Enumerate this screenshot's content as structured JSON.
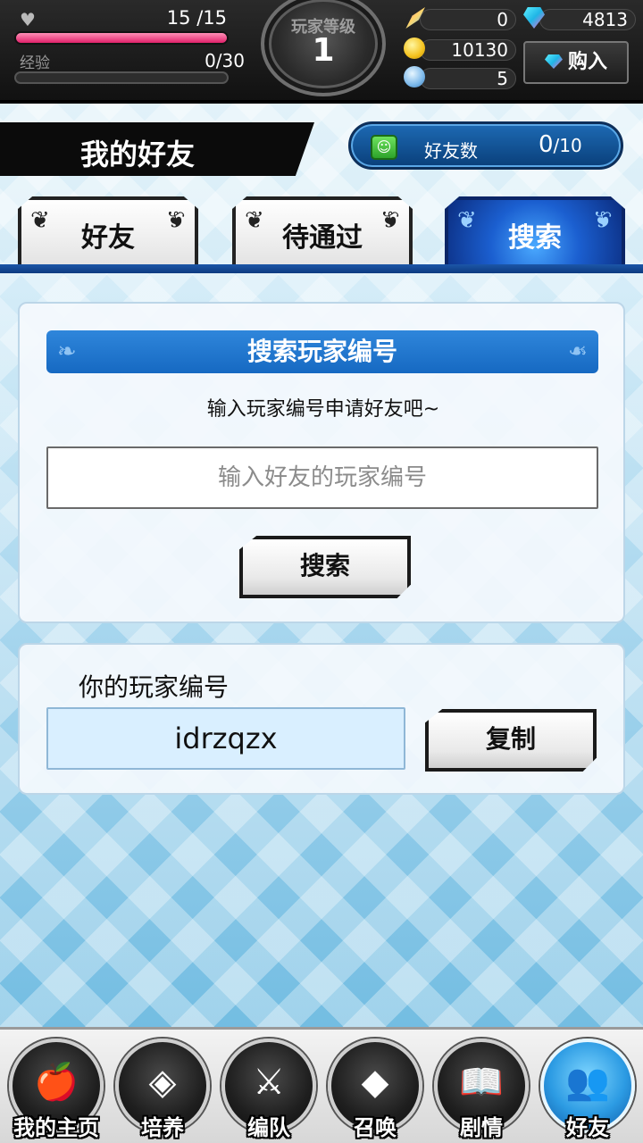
{
  "hud": {
    "hp_text": "15 /15",
    "hp_fraction": 1.0,
    "exp_label": "经验",
    "exp_text": "0/30",
    "exp_fraction": 0.0,
    "level_title": "玩家等级",
    "level_value": "1",
    "feather_value": "0",
    "diamond_value": "4813",
    "coin_value": "10130",
    "orb_value": "5",
    "buy_label": "购入"
  },
  "title": {
    "page_title": "我的好友",
    "friend_count_label": "好友数",
    "friend_count_current": "0",
    "friend_count_max": "/10"
  },
  "tabs": [
    {
      "label": "好友",
      "active": false
    },
    {
      "label": "待通过",
      "active": false
    },
    {
      "label": "搜索",
      "active": true
    }
  ],
  "search_panel": {
    "header": "搜索玩家编号",
    "hint": "输入玩家编号申请好友吧~",
    "input_placeholder": "输入好友的玩家编号",
    "search_button": "搜索"
  },
  "my_id_panel": {
    "label": "你的玩家编号",
    "player_id": "idrzqzx",
    "copy_button": "复制"
  },
  "bottom_nav": [
    {
      "label": "我的主页",
      "icon": "apple-icon",
      "active": false
    },
    {
      "label": "培养",
      "icon": "gem-cluster-icon",
      "active": false
    },
    {
      "label": "编队",
      "icon": "crossed-swords-icon",
      "active": false
    },
    {
      "label": "召唤",
      "icon": "diamond-icon",
      "active": false
    },
    {
      "label": "剧情",
      "icon": "book-icon",
      "active": false
    },
    {
      "label": "好友",
      "icon": "friends-icon",
      "active": true
    }
  ],
  "colors": {
    "accent_blue": "#1669c2",
    "hp_pink": "#e0216a",
    "active_tab": "#1b5fd0"
  }
}
